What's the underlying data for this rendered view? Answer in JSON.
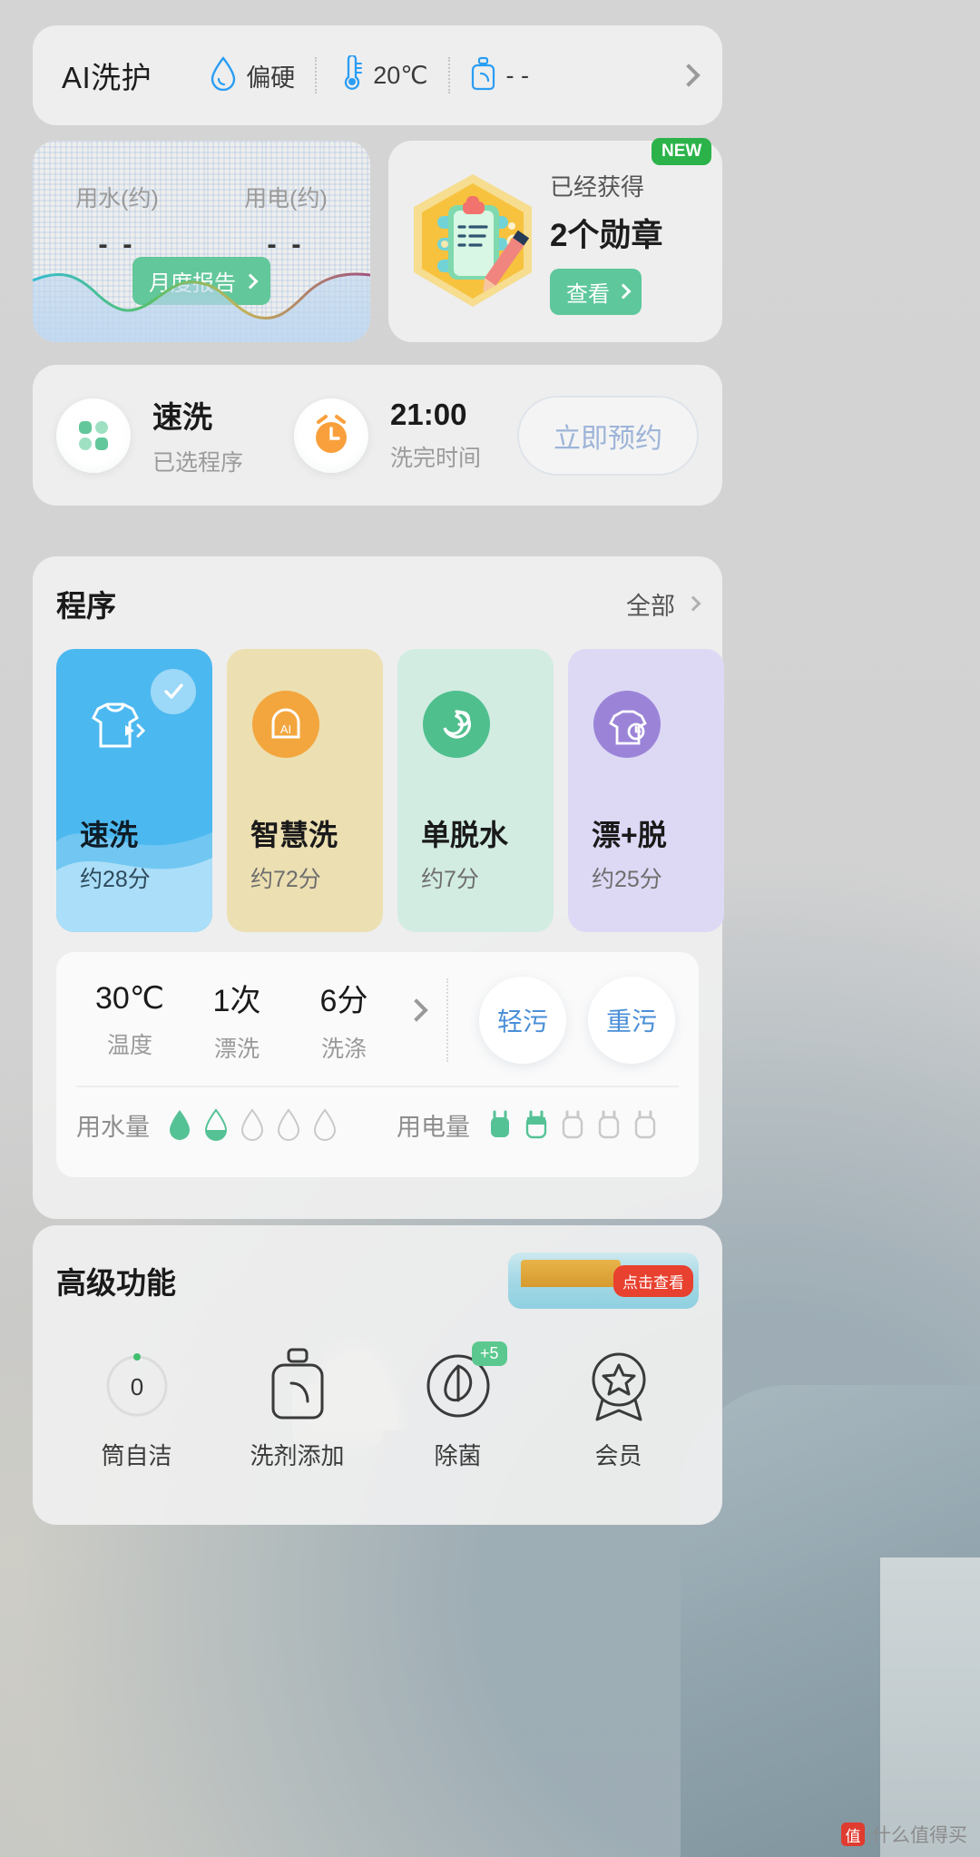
{
  "ai_bar": {
    "title": "AI洗护",
    "items": [
      {
        "icon": "water-drop-icon",
        "value": "偏硬"
      },
      {
        "icon": "thermometer-icon",
        "value": "20℃"
      },
      {
        "icon": "detergent-bottle-icon",
        "value": "- -"
      }
    ],
    "chevron": "chevron-right-icon"
  },
  "usage": {
    "columns": [
      {
        "label": "用水(约)",
        "value": "- -"
      },
      {
        "label": "用电(约)",
        "value": "- -"
      }
    ],
    "report_button": "月度报告"
  },
  "badge": {
    "new_tag": "NEW",
    "got_label": "已经获得",
    "count_text": "2个勋章",
    "view_button": "查看"
  },
  "status": {
    "program_name": "速洗",
    "program_sub": "已选程序",
    "finish_time": "21:00",
    "finish_sub": "洗完时间",
    "reserve_button": "立即预约"
  },
  "programs": {
    "title": "程序",
    "all_label": "全部",
    "cards": [
      {
        "name": "速洗",
        "duration": "约28分",
        "selected": true,
        "icon": "shirt-fast-icon"
      },
      {
        "name": "智慧洗",
        "duration": "约72分",
        "selected": false,
        "icon": "ai-head-icon"
      },
      {
        "name": "单脱水",
        "duration": "约7分",
        "selected": false,
        "icon": "spin-icon"
      },
      {
        "name": "漂+脱",
        "duration": "约25分",
        "selected": false,
        "icon": "shirt-rinse-icon"
      }
    ],
    "settings": {
      "items": [
        {
          "value": "30℃",
          "label": "温度"
        },
        {
          "value": "1次",
          "label": "漂洗"
        },
        {
          "value": "6分",
          "label": "洗涤"
        }
      ],
      "arrow": "chevron-right-icon",
      "soil_buttons": [
        "轻污",
        "重污"
      ],
      "water_meter": {
        "label": "用水量",
        "filled": 1,
        "half": 1,
        "total": 5
      },
      "power_meter": {
        "label": "用电量",
        "filled": 2,
        "total": 5
      }
    }
  },
  "advanced": {
    "title": "高级功能",
    "banner_text": "点击查看",
    "items": [
      {
        "name": "筒自洁",
        "icon": "drum-ring-icon",
        "value": "0"
      },
      {
        "name": "洗剂添加",
        "icon": "detergent-bottle-icon",
        "value": ""
      },
      {
        "name": "除菌",
        "icon": "leaf-icon",
        "value": "",
        "badge": "+5"
      },
      {
        "name": "会员",
        "icon": "medal-star-icon",
        "value": ""
      }
    ]
  },
  "watermark": {
    "mark": "值",
    "text": "什么值得买"
  },
  "colors": {
    "accent_green": "#5ec79c",
    "selected_blue": "#4cb8f0",
    "soil_text": "#4a8fd8",
    "new_green": "#2bb34a"
  }
}
